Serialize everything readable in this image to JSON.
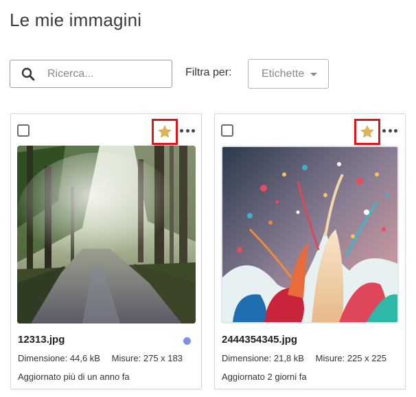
{
  "page": {
    "title": "Le mie immagini"
  },
  "toolbar": {
    "search_placeholder": "Ricerca...",
    "search_value": "",
    "filter_label": "Filtra per:",
    "tags_dropdown_label": "Etichette"
  },
  "colors": {
    "favorite_star": "#e0b25a",
    "highlight_border": "#e0161c",
    "status_dot": "#7f8ff0"
  },
  "cards": [
    {
      "file_name": "12313.jpg",
      "size_label": "Dimensione:",
      "size_value": "44,6 kB",
      "dimensions_label": "Misure:",
      "dimensions_value": "275 x 183",
      "updated": "Aggiornato più di un anno fa",
      "favorite": true,
      "checked": false,
      "status_dot": true,
      "thumbnail_icon": "forest-road-photo"
    },
    {
      "file_name": "2444354345.jpg",
      "size_label": "Dimensione:",
      "size_value": "21,8 kB",
      "dimensions_label": "Misure:",
      "dimensions_value": "225 x 225",
      "updated": "Aggiornato 2 giorni fa",
      "favorite": true,
      "checked": false,
      "status_dot": false,
      "thumbnail_icon": "paint-splash-photo"
    }
  ]
}
